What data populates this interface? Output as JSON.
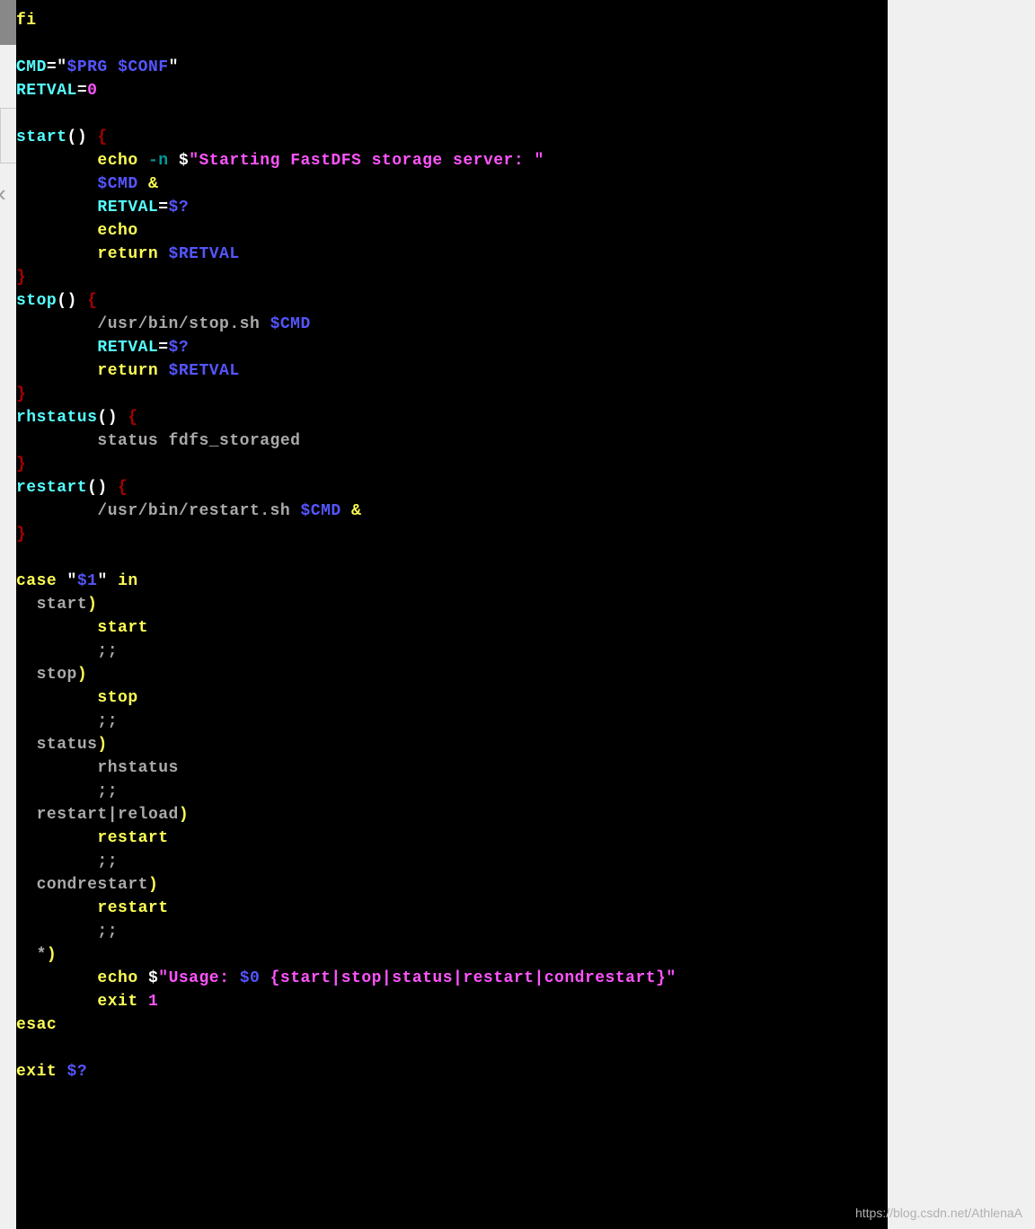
{
  "watermark": "https://blog.csdn.net/AthlenaA",
  "code": {
    "l1_fi": "fi",
    "l3_cmd": "CMD",
    "l3_eq": "=",
    "l3_q1": "\"",
    "l3_prg": "$PRG",
    "l3_sp": " ",
    "l3_conf": "$CONF",
    "l3_q2": "\"",
    "l4_retval": "RETVAL",
    "l4_eq": "=",
    "l4_zero": "0",
    "l6_start": "start",
    "l6_paren": "()",
    "l6_sp": " ",
    "l6_brace": "{",
    "l7_indent": "        ",
    "l7_echo": "echo",
    "l7_sp1": " ",
    "l7_n": "-n",
    "l7_sp2": " ",
    "l7_dollar": "$",
    "l7_str": "\"Starting FastDFS storage server: \"",
    "l8_indent": "        ",
    "l8_cmd": "$CMD",
    "l8_sp": " ",
    "l8_amp": "&",
    "l9_indent": "        ",
    "l9_retval": "RETVAL",
    "l9_eq": "=",
    "l9_q": "$?",
    "l10_indent": "        ",
    "l10_echo": "echo",
    "l11_indent": "        ",
    "l11_return": "return",
    "l11_sp": " ",
    "l11_retval": "$RETVAL",
    "l12_brace": "}",
    "l13_stop": "stop",
    "l13_paren": "()",
    "l13_sp": " ",
    "l13_brace": "{",
    "l14_indent": "        ",
    "l14_path": "/usr/bin/stop.sh ",
    "l14_cmd": "$CMD",
    "l15_indent": "        ",
    "l15_retval": "RETVAL",
    "l15_eq": "=",
    "l15_q": "$?",
    "l16_indent": "        ",
    "l16_return": "return",
    "l16_sp": " ",
    "l16_retval": "$RETVAL",
    "l17_brace": "}",
    "l18_rhstatus": "rhstatus",
    "l18_paren": "()",
    "l18_sp": " ",
    "l18_brace": "{",
    "l19_indent": "        ",
    "l19_status": "status fdfs_storaged",
    "l20_brace": "}",
    "l21_restart": "restart",
    "l21_paren": "()",
    "l21_sp": " ",
    "l21_brace": "{",
    "l22_indent": "        ",
    "l22_path": "/usr/bin/restart.sh ",
    "l22_cmd": "$CMD",
    "l22_sp": " ",
    "l22_amp": "&",
    "l23_brace": "}",
    "l25_case": "case",
    "l25_sp1": " ",
    "l25_q1": "\"",
    "l25_arg": "$1",
    "l25_q2": "\"",
    "l25_sp2": " ",
    "l25_in": "in",
    "l26_indent": "  ",
    "l26_start": "start",
    "l26_paren": ")",
    "l27_indent": "        ",
    "l27_start": "start",
    "l28_indent": "        ",
    "l28_semi": ";;",
    "l29_indent": "  ",
    "l29_stop": "stop",
    "l29_paren": ")",
    "l30_indent": "        ",
    "l30_stop": "stop",
    "l31_indent": "        ",
    "l31_semi": ";;",
    "l32_indent": "  ",
    "l32_status": "status",
    "l32_paren": ")",
    "l33_indent": "        ",
    "l33_rhstatus": "rhstatus",
    "l34_indent": "        ",
    "l34_semi": ";;",
    "l35_indent": "  ",
    "l35_restart": "restart",
    "l35_pipe": "|",
    "l35_reload": "reload",
    "l35_paren": ")",
    "l36_indent": "        ",
    "l36_restart": "restart",
    "l37_indent": "        ",
    "l37_semi": ";;",
    "l38_indent": "  ",
    "l38_condrestart": "condrestart",
    "l38_paren": ")",
    "l39_indent": "        ",
    "l39_restart": "restart",
    "l40_indent": "        ",
    "l40_semi": ";;",
    "l41_indent": "  ",
    "l41_star": "*",
    "l41_paren": ")",
    "l42_indent": "        ",
    "l42_echo": "echo",
    "l42_sp": " ",
    "l42_dollar": "$",
    "l42_q1": "\"Usage: ",
    "l42_arg": "$0",
    "l42_q2": " {start|stop|status|restart|condrestart}\"",
    "l43_indent": "        ",
    "l43_exit": "exit",
    "l43_sp": " ",
    "l43_one": "1",
    "l44_esac": "esac",
    "l46_exit": "exit",
    "l46_sp": " ",
    "l46_q": "$?"
  }
}
